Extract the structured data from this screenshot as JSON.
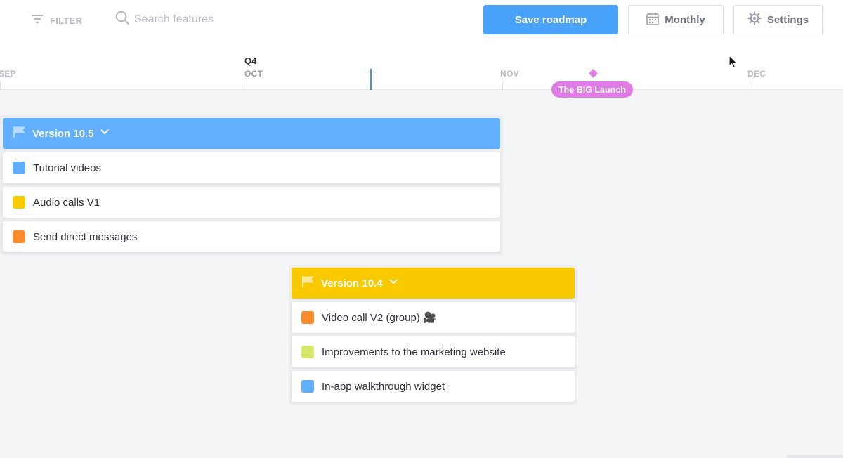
{
  "toolbar": {
    "filter_label": "FILTER",
    "search_placeholder": "Search features",
    "save_label": "Save roadmap",
    "view_label": "Monthly",
    "settings_label": "Settings"
  },
  "timeline": {
    "quarter": "Q4",
    "months": [
      "SEP",
      "OCT",
      "NOV",
      "DEC"
    ],
    "milestone": "The BIG Launch"
  },
  "releases": [
    {
      "name": "Version 10.5",
      "color": "#62afff",
      "features": [
        {
          "name": "Tutorial videos",
          "color": "#62afff"
        },
        {
          "name": "Audio calls V1",
          "color": "#f9c900"
        },
        {
          "name": "Send direct messages",
          "color": "#fb8c2e"
        }
      ]
    },
    {
      "name": "Version 10.4",
      "color": "#f9c900",
      "features": [
        {
          "name": "Video call V2 (group) 🎥",
          "color": "#fb8c2e"
        },
        {
          "name": "Improvements to the marketing website",
          "color": "#d6e86a"
        },
        {
          "name": "In-app walkthrough widget",
          "color": "#62afff"
        }
      ]
    }
  ]
}
